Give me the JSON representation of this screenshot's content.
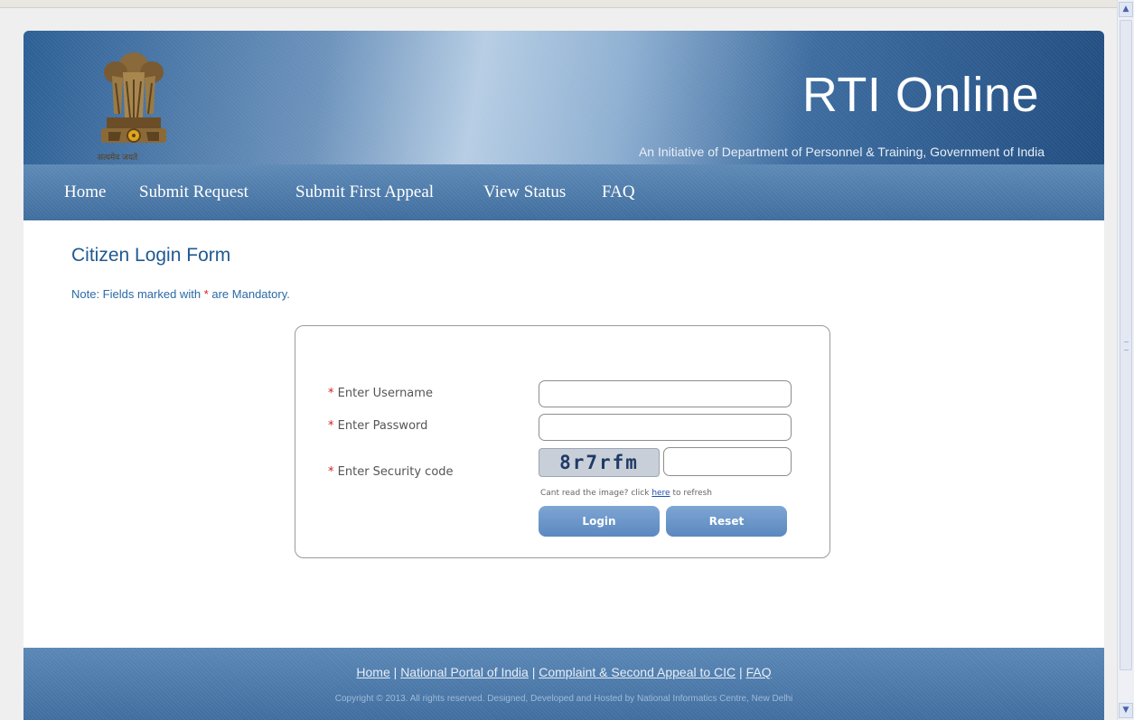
{
  "header": {
    "title": "RTI Online",
    "subtitle": "An Initiative of Department of Personnel & Training, Government of India",
    "motto": "सत्यमेव जयते"
  },
  "nav": {
    "items": [
      {
        "label": "Home"
      },
      {
        "label": "Submit Request"
      },
      {
        "label": "Submit First Appeal"
      },
      {
        "label": "View Status"
      },
      {
        "label": "FAQ"
      }
    ]
  },
  "form": {
    "title": "Citizen Login Form",
    "note_prefix": "Note: Fields marked with",
    "note_suffix": "are Mandatory.",
    "required_marker": "*",
    "username_label": "Enter Username",
    "password_label": "Enter Password",
    "captcha_label": "Enter Security code",
    "username_value": "",
    "password_value": "",
    "captcha_value": "",
    "captcha_text": "8r7rfm",
    "refresh_prefix": "Cant read the image? click",
    "refresh_link": "here",
    "refresh_suffix": "to refresh",
    "login_label": "Login",
    "reset_label": "Reset"
  },
  "footer": {
    "links": [
      "Home",
      "National Portal of India",
      "Complaint & Second Appeal to CIC",
      "FAQ"
    ],
    "separator": "|",
    "copyright": "Copyright © 2013. All rights reserved. Designed, Developed and Hosted by National Informatics Centre, New Delhi"
  },
  "colors": {
    "brand_blue": "#3f6d9e",
    "title_blue": "#1f5a92",
    "required_red": "#d21d1d"
  },
  "icons": {
    "emblem": "state-emblem-icon",
    "scroll_up": "scroll-up-arrow-icon",
    "scroll_down": "scroll-down-arrow-icon"
  }
}
